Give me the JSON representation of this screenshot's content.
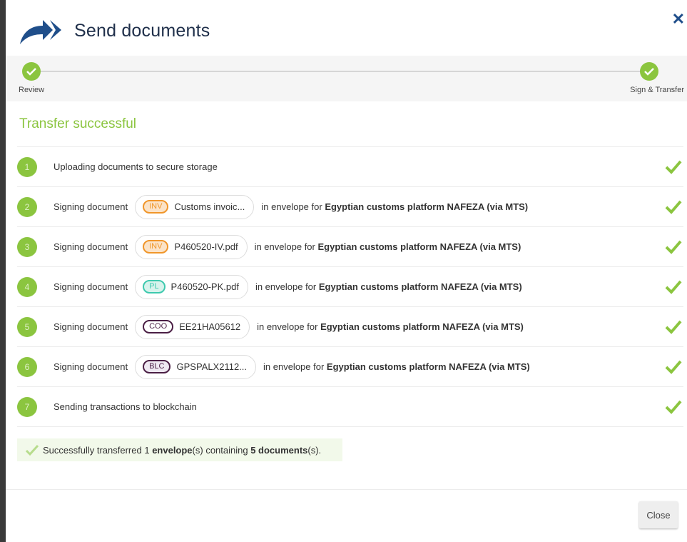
{
  "header": {
    "title": "Send documents",
    "close_label": "✕"
  },
  "stepper": {
    "steps": [
      {
        "label": "Review"
      },
      {
        "label": "Sign & Transfer"
      }
    ]
  },
  "section_title": "Transfer successful",
  "rows": [
    {
      "num": "1",
      "text": "Uploading documents to secure storage"
    },
    {
      "num": "2",
      "prefix": "Signing document",
      "tag": "INV",
      "doc": "Customs invoic...",
      "suffix_pre": "in envelope for ",
      "suffix_bold": "Egyptian customs platform NAFEZA (via MTS)"
    },
    {
      "num": "3",
      "prefix": "Signing document",
      "tag": "INV",
      "doc": "P460520-IV.pdf",
      "suffix_pre": "in envelope for ",
      "suffix_bold": "Egyptian customs platform NAFEZA (via MTS)"
    },
    {
      "num": "4",
      "prefix": "Signing document",
      "tag": "PL",
      "doc": "P460520-PK.pdf",
      "suffix_pre": "in envelope for ",
      "suffix_bold": "Egyptian customs platform NAFEZA (via MTS)"
    },
    {
      "num": "5",
      "prefix": "Signing document",
      "tag": "COO",
      "doc": "EE21HA05612",
      "suffix_pre": "in envelope for ",
      "suffix_bold": "Egyptian customs platform NAFEZA (via MTS)"
    },
    {
      "num": "6",
      "prefix": "Signing document",
      "tag": "BLC",
      "doc": "GPSPALX2112...",
      "suffix_pre": "in envelope for ",
      "suffix_bold": "Egyptian customs platform NAFEZA (via MTS)"
    },
    {
      "num": "7",
      "text": "Sending transactions to blockchain"
    }
  ],
  "success": {
    "pre": "Successfully transferred 1 ",
    "envelope": "envelope",
    "mid": "(s) containing ",
    "docs": "5 documents",
    "post": "(s)."
  },
  "footer": {
    "close_button": "Close"
  },
  "colors": {
    "accent_green": "#8bc53f",
    "inv_orange": "#f0962a",
    "pl_teal": "#3ec9ae",
    "coo_purple": "#4b1f45",
    "title_navy": "#1f2f4a"
  },
  "icons": {
    "logo": "forward-arrows-logo",
    "step": "check-icon",
    "row_status": "check-icon",
    "close": "close-icon"
  }
}
